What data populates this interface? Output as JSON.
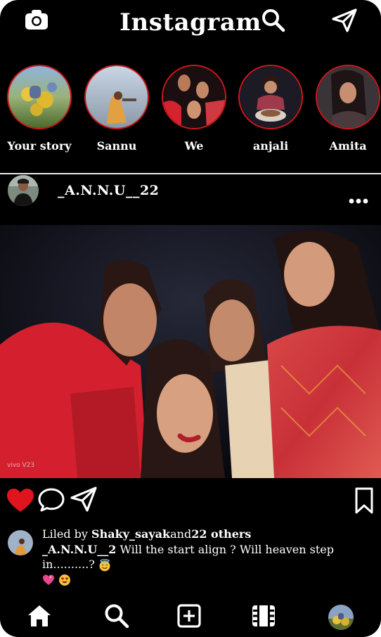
{
  "app": {
    "title": "Instagram"
  },
  "header": {
    "camera_icon": "camera-icon",
    "search_icon": "search-icon",
    "send_icon": "paper-plane-icon"
  },
  "stories": [
    {
      "label": "Your story"
    },
    {
      "label": "Sannu"
    },
    {
      "label": "We"
    },
    {
      "label": "anjali"
    },
    {
      "label": "Amita"
    }
  ],
  "post": {
    "username": "_A.N.N.U__22",
    "watermark": "vivo V23",
    "likes": {
      "prefix": "Liled by ",
      "user": "Shaky_sayak",
      "mid": "and",
      "count": "22 others"
    },
    "caption": {
      "user": "_A.N.N.U__2",
      "text": " Will the start align ? Will heaven step in..........? "
    }
  },
  "nav": [
    "home-icon",
    "search-icon",
    "add-post-icon",
    "reels-icon",
    "profile-avatar"
  ],
  "colors": {
    "accent_red": "#e0141e",
    "story_ring": "#d01818",
    "background": "#000000"
  }
}
